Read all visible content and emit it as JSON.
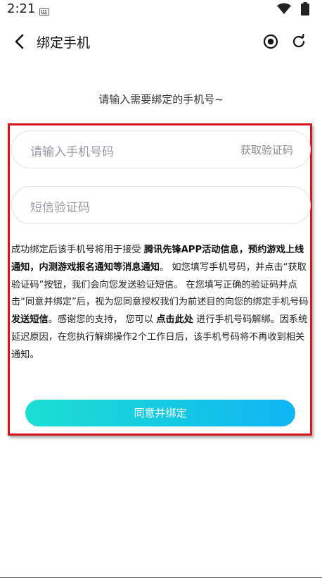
{
  "status_bar": {
    "time": "2:21",
    "icons": [
      "keyboard-icon",
      "wifi-icon",
      "battery-icon"
    ]
  },
  "header": {
    "title": "绑定手机",
    "icons": [
      "back-icon",
      "target-icon",
      "refresh-icon"
    ]
  },
  "prompt": "请输入需要绑定的手机号~",
  "phone_field": {
    "placeholder": "请输入手机号码",
    "get_code_label": "获取验证码"
  },
  "code_field": {
    "placeholder": "短信验证码"
  },
  "notice": {
    "p1": "成功绑定后该手机号将用于接受 ",
    "b1": "腾讯先锋APP活动信息，预约游戏上线通知，内测游戏报名通知等消息通知",
    "p2": "。 如您填写手机号码，并点击“获取验证码”按钮，我们会向您发送验证短信。 在您填写正确的验证码并点击“同意并绑定”后，视为您同意授权我们为前述目的向您的绑定手机号码 ",
    "b2": "发送短信",
    "p3": "。感谢您的支持， 您可以 ",
    "b3": "点击此处",
    "p4": " 进行手机号码解绑。因系统延迟原因，在您执行解绑操作2个工作日后，该手机号码将不再收到相关通知。"
  },
  "bind_button": "同意并绑定",
  "colors": {
    "accent_start": "#1cdfd2",
    "accent_end": "#0eb6f3",
    "highlight": "#d9141f"
  }
}
